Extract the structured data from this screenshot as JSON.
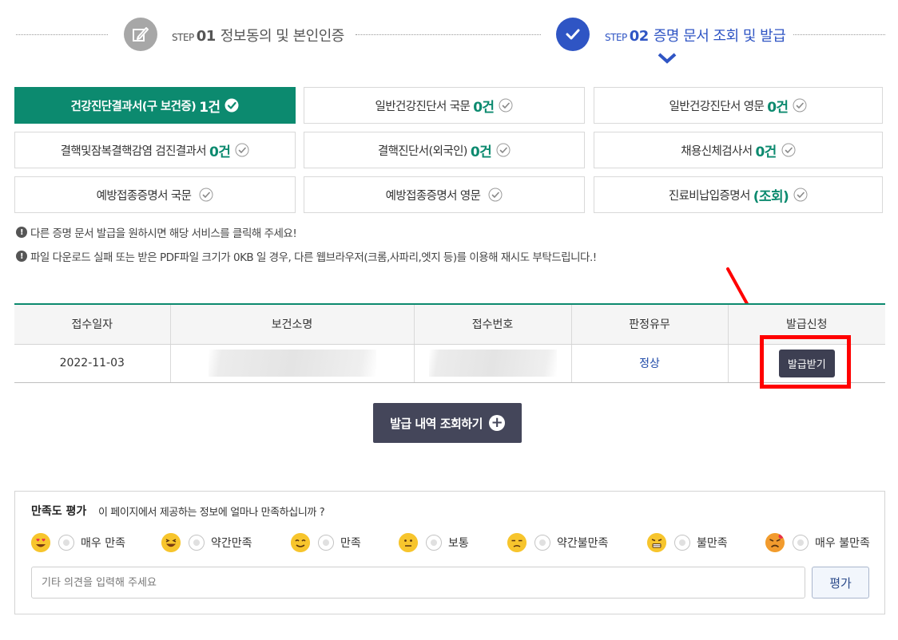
{
  "steps": [
    {
      "prefix": "STEP",
      "number": "01",
      "label": "정보동의 및 본인인증",
      "state": "done"
    },
    {
      "prefix": "STEP",
      "number": "02",
      "label": "증명 문서 조회 및 발급",
      "state": "current"
    }
  ],
  "tabs": [
    {
      "label": "건강진단결과서(구 보건증)",
      "count": "1건",
      "active": true
    },
    {
      "label": "일반건강진단서 국문",
      "count": "0건"
    },
    {
      "label": "일반건강진단서 영문",
      "count": "0건"
    },
    {
      "label": "결핵및잠복결핵감염 검진결과서",
      "count": "0건"
    },
    {
      "label": "결핵진단서(외국인)",
      "count": "0건"
    },
    {
      "label": "채용신체검사서",
      "count": "0건"
    },
    {
      "label": "예방접종증명서 국문",
      "count": ""
    },
    {
      "label": "예방접종증명서 영문",
      "count": ""
    },
    {
      "label": "진료비납입증명서",
      "count": "(조회)"
    }
  ],
  "notices": [
    "다른 증명 문서 발급을 원하시면 해당 서비스를 클릭해 주세요!",
    "파일 다운로드 실패 또는 받은 PDF파일 크기가 0KB 일 경우, 다른 웹브라우저(크롬,사파리,엣지 등)를 이용해 재시도 부탁드립니다.!"
  ],
  "table": {
    "headers": [
      "접수일자",
      "보건소명",
      "접수번호",
      "판정유무",
      "발급신청"
    ],
    "rows": [
      {
        "date": "2022-11-03",
        "status": "정상",
        "action": "발급받기"
      }
    ]
  },
  "history_button": "발급 내역 조회하기",
  "survey": {
    "title": "만족도 평가",
    "question": "이 페이지에서 제공하는 정보에 얼마나 만족하십니까 ?",
    "options": [
      "매우 만족",
      "약간만족",
      "만족",
      "보통",
      "약간불만족",
      "불만족",
      "매우 불만족"
    ],
    "placeholder": "기타 의견을 입력해 주세요",
    "submit": "평가"
  },
  "colors": {
    "accent": "#0c8a6f",
    "step_blue": "#2f55c4",
    "highlight": "#ff0000",
    "dark_button": "#3d3f52"
  }
}
